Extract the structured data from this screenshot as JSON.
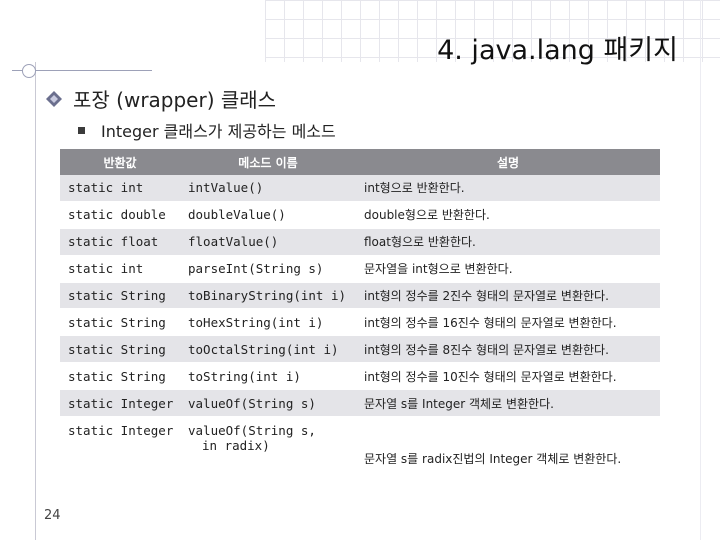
{
  "slide": {
    "title": "4. java.lang 패키지",
    "bullet1": "포장 (wrapper) 클래스",
    "bullet2": "Integer 클래스가 제공하는 메소드",
    "page_number": "24"
  },
  "table": {
    "headers": [
      "반환값",
      "메소드 이름",
      "설명"
    ],
    "rows": [
      {
        "ret": "static int",
        "method": "intValue()",
        "method2": "",
        "desc": "int형으로 반환한다."
      },
      {
        "ret": "static double",
        "method": "doubleValue()",
        "method2": "",
        "desc": "double형으로 반환한다."
      },
      {
        "ret": "static float",
        "method": "floatValue()",
        "method2": "",
        "desc": "float형으로 반환한다."
      },
      {
        "ret": "static int",
        "method": "parseInt(String s)",
        "method2": "",
        "desc": "문자열을 int형으로 변환한다."
      },
      {
        "ret": "static String",
        "method": "toBinaryString(int i)",
        "method2": "",
        "desc": "int형의 정수를 2진수 형태의 문자열로 변환한다."
      },
      {
        "ret": "static String",
        "method": "toHexString(int i)",
        "method2": "",
        "desc": "int형의 정수를 16진수 형태의 문자열로 변환한다."
      },
      {
        "ret": "static String",
        "method": "toOctalString(int i)",
        "method2": "",
        "desc": "int형의 정수를 8진수 형태의 문자열로 변환한다."
      },
      {
        "ret": "static String",
        "method": "toString(int i)",
        "method2": "",
        "desc": "int형의 정수를 10진수 형태의 문자열로 변환한다."
      },
      {
        "ret": "static Integer",
        "method": "valueOf(String s)",
        "method2": "",
        "desc": "문자열 s를 Integer 객체로 변환한다."
      },
      {
        "ret": "static Integer",
        "method": "valueOf(String s,",
        "method2": "in radix)",
        "desc": "문자열 s를 radix진법의 Integer 객체로 변환한다."
      }
    ]
  },
  "colors": {
    "header_bg": "#8a8a8f",
    "stripe_bg": "#e4e4e8"
  }
}
